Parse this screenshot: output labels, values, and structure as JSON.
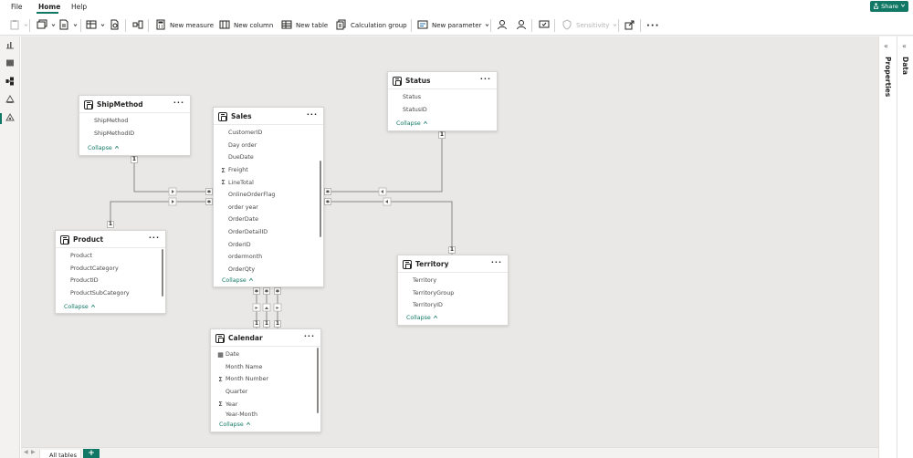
{
  "menu": {
    "items": [
      {
        "key": "file",
        "label": "File"
      },
      {
        "key": "home",
        "label": "Home"
      },
      {
        "key": "help",
        "label": "Help"
      }
    ],
    "active": "Home",
    "share_label": "Share"
  },
  "ribbon": {
    "new_measure": "New measure",
    "new_column": "New column",
    "new_table": "New table",
    "calculation_group": "Calculation group",
    "new_parameter": "New parameter",
    "sensitivity": "Sensitivity"
  },
  "right_panes": {
    "properties": "Properties",
    "data": "Data"
  },
  "bottom": {
    "tab_label": "All tables",
    "add_label": "+"
  },
  "tables": {
    "shipmethod": {
      "title": "ShipMethod",
      "fields": [
        {
          "name": "ShipMethod",
          "sym": ""
        },
        {
          "name": "ShipMethodID",
          "sym": ""
        }
      ],
      "collapse": "Collapse"
    },
    "sales": {
      "title": "Sales",
      "fields": [
        {
          "name": "CustomerID",
          "sym": ""
        },
        {
          "name": "Day order",
          "sym": ""
        },
        {
          "name": "DueDate",
          "sym": ""
        },
        {
          "name": "Freight",
          "sym": "Σ"
        },
        {
          "name": "LineTotal",
          "sym": "Σ"
        },
        {
          "name": "OnlineOrderFlag",
          "sym": ""
        },
        {
          "name": "order year",
          "sym": ""
        },
        {
          "name": "OrderDate",
          "sym": ""
        },
        {
          "name": "OrderDetailID",
          "sym": ""
        },
        {
          "name": "OrderID",
          "sym": ""
        },
        {
          "name": "ordermonth",
          "sym": ""
        },
        {
          "name": "OrderQty",
          "sym": ""
        }
      ],
      "collapse": "Collapse"
    },
    "status": {
      "title": "Status",
      "fields": [
        {
          "name": "Status",
          "sym": ""
        },
        {
          "name": "StatusID",
          "sym": ""
        }
      ],
      "collapse": "Collapse"
    },
    "product": {
      "title": "Product",
      "fields": [
        {
          "name": "Product",
          "sym": ""
        },
        {
          "name": "ProductCategory",
          "sym": ""
        },
        {
          "name": "ProductID",
          "sym": ""
        },
        {
          "name": "ProductSubCategory",
          "sym": ""
        }
      ],
      "collapse": "Collapse"
    },
    "territory": {
      "title": "Territory",
      "fields": [
        {
          "name": "Territory",
          "sym": ""
        },
        {
          "name": "TerritoryGroup",
          "sym": ""
        },
        {
          "name": "TerritoryID",
          "sym": ""
        }
      ],
      "collapse": "Collapse"
    },
    "calendar": {
      "title": "Calendar",
      "fields": [
        {
          "name": "Date",
          "sym": "▦"
        },
        {
          "name": "Month Name",
          "sym": ""
        },
        {
          "name": "Month Number",
          "sym": "Σ"
        },
        {
          "name": "Quarter",
          "sym": ""
        },
        {
          "name": "Year",
          "sym": "Σ"
        },
        {
          "name": "Year-Month",
          "sym": ""
        }
      ],
      "collapse": "Collapse"
    }
  },
  "cardinality": {
    "one": "1",
    "many": "*"
  },
  "colors": {
    "accent": "#117865",
    "canvas": "#e9e8e6",
    "line": "#8a8886"
  },
  "icons": {
    "collapse": "chevron-up-icon",
    "more": "ellipsis-icon",
    "table": "table-icon"
  }
}
